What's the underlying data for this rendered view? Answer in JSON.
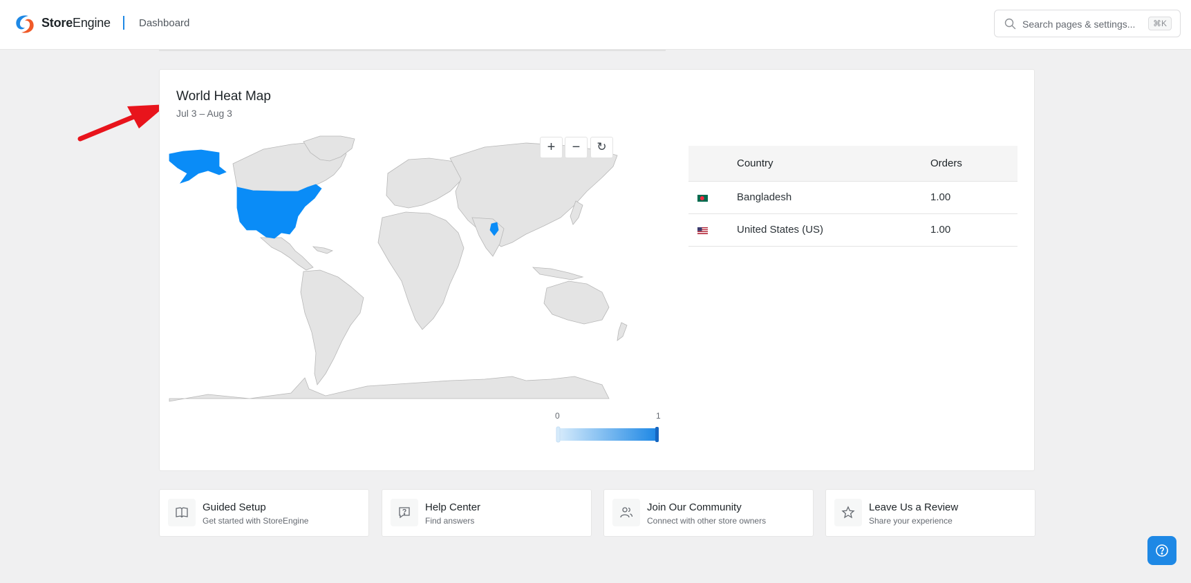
{
  "header": {
    "brand_bold": "Store",
    "brand_rest": "Engine",
    "breadcrumb": "Dashboard",
    "search_placeholder": "Search pages & settings...",
    "search_shortcut": "⌘K"
  },
  "card": {
    "title": "World Heat Map",
    "date_range": "Jul 3 – Aug 3",
    "map_controls": {
      "zoom_in": "+",
      "zoom_out": "−",
      "reset": "↻"
    },
    "legend": {
      "min": "0",
      "max": "1",
      "min_color": "#d6ebfb",
      "max_color": "#1e88e5"
    },
    "highlighted_countries": [
      "United States (US)",
      "Bangladesh"
    ],
    "highlight_color": "#0a8cf7",
    "land_color": "#e4e4e4"
  },
  "table": {
    "headers": [
      "",
      "Country",
      "Orders"
    ],
    "rows": [
      {
        "flag": "bangladesh-flag",
        "country": "Bangladesh",
        "orders": "1.00"
      },
      {
        "flag": "us-flag",
        "country": "United States (US)",
        "orders": "1.00"
      }
    ]
  },
  "tiles": [
    {
      "title": "Guided Setup",
      "desc": "Get started with StoreEngine",
      "icon": "book-icon"
    },
    {
      "title": "Help Center",
      "desc": "Find answers",
      "icon": "chat-question-icon"
    },
    {
      "title": "Join Our Community",
      "desc": "Connect with other store owners",
      "icon": "users-icon"
    },
    {
      "title": "Leave Us a Review",
      "desc": "Share your experience",
      "icon": "star-icon"
    }
  ],
  "accent": "#1e88e5",
  "annotation_arrow_color": "#e8141c"
}
